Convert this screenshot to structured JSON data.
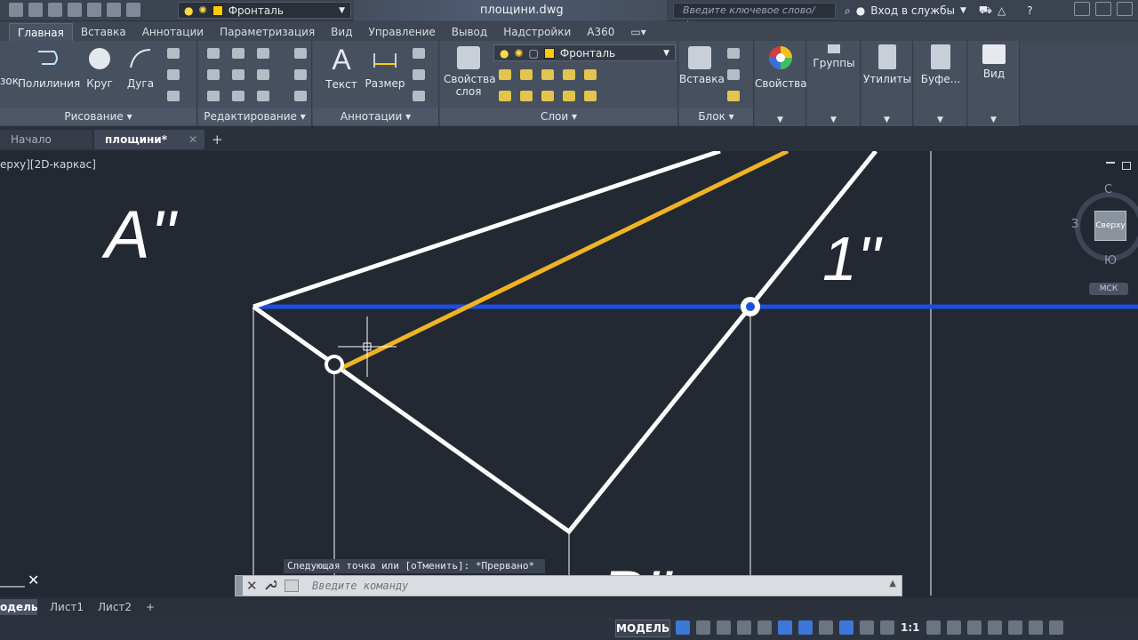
{
  "app": {
    "doc_title": "площини.dwg",
    "search_placeholder": "Введите ключевое слово/фразу",
    "signin_label": "Вход в службы",
    "qat_layer": "Фронталь"
  },
  "ribbon": {
    "tabs": [
      "Главная",
      "Вставка",
      "Аннотации",
      "Параметризация",
      "Вид",
      "Управление",
      "Вывод",
      "Надстройки",
      "A360"
    ],
    "draw": {
      "title": "Рисование",
      "items": [
        "зок",
        "Полилиния",
        "Круг",
        "Дуга"
      ]
    },
    "modify": {
      "title": "Редактирование"
    },
    "annotate": {
      "title": "Аннотации",
      "items": [
        "Текст",
        "Размер"
      ]
    },
    "layers": {
      "title": "Слои",
      "props_label": "Свойства слоя",
      "current_layer": "Фронталь"
    },
    "block": {
      "title": "Блок",
      "insert_label": "Вставка"
    },
    "properties_label": "Свойства",
    "groups_label": "Группы",
    "utilities_label": "Утилиты",
    "clipboard_label": "Буфе...",
    "view_label": "Вид"
  },
  "file_tabs": {
    "start": "Начало",
    "current": "площини*"
  },
  "viewport": {
    "label": "ерху][2D-каркас]",
    "viewcube": {
      "face": "Сверху",
      "north": "С",
      "south": "Ю",
      "west": "З",
      "ucs": "МСК"
    }
  },
  "drawing": {
    "labels": {
      "a2": "A''",
      "one2": "1''",
      "b2_partial": "B''"
    },
    "colors": {
      "white": "#ffffff",
      "orange": "#f0b323",
      "blue": "#1b4fe0",
      "bg": "#222933"
    }
  },
  "command": {
    "history": "Следующая точка или [оТменить]: *Прервано*",
    "placeholder": "Введите команду"
  },
  "layout_tabs": [
    "одель",
    "Лист1",
    "Лист2"
  ],
  "status": {
    "model": "МОДЕЛЬ",
    "scale": "1:1"
  }
}
